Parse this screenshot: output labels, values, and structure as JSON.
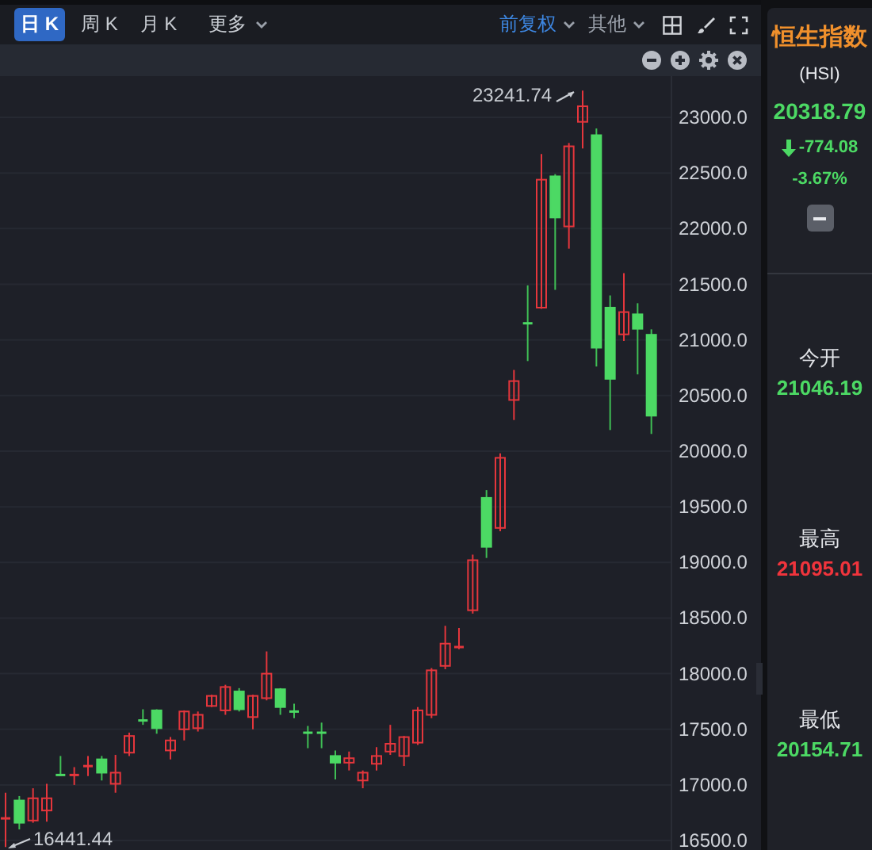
{
  "toolbar": {
    "tabs": [
      {
        "label": "日 K",
        "selected": true
      },
      {
        "label": "周 K",
        "selected": false
      },
      {
        "label": "月 K",
        "selected": false
      }
    ],
    "more": {
      "label": "更多"
    },
    "options": [
      {
        "label": "前复权",
        "active": true
      },
      {
        "label": "其他",
        "active": false
      }
    ]
  },
  "chart": {
    "max_label": "23241.74",
    "min_label": "16441.44",
    "chart_data": {
      "type": "candlestick",
      "categories": [
        null,
        null,
        null,
        null,
        null,
        null,
        null,
        null,
        null,
        null,
        null,
        null,
        null,
        null,
        null,
        null,
        null,
        null,
        null,
        null,
        null,
        null,
        null,
        null,
        null,
        null,
        null,
        null,
        null,
        null,
        null,
        null,
        null,
        null,
        null,
        null,
        null,
        null,
        null,
        null,
        null,
        null,
        null,
        null,
        null,
        null,
        null,
        null
      ],
      "ohlc": [
        [
          16700,
          16930,
          16441.44,
          16710
        ],
        [
          16860,
          16900,
          16600,
          16660
        ],
        [
          16680,
          16970,
          16660,
          16880
        ],
        [
          16770,
          17010,
          16670,
          16880
        ],
        [
          17100,
          17260,
          17080,
          17090
        ],
        [
          17090,
          17160,
          17000,
          17100
        ],
        [
          17170,
          17260,
          17080,
          17180
        ],
        [
          17230,
          17260,
          17040,
          17110
        ],
        [
          17010,
          17270,
          16930,
          17110
        ],
        [
          17290,
          17470,
          17260,
          17440
        ],
        [
          17590,
          17680,
          17540,
          17580
        ],
        [
          17670,
          17680,
          17460,
          17510
        ],
        [
          17310,
          17430,
          17230,
          17400
        ],
        [
          17500,
          17670,
          17400,
          17660
        ],
        [
          17510,
          17660,
          17480,
          17630
        ],
        [
          17710,
          17810,
          17700,
          17800
        ],
        [
          17670,
          17900,
          17630,
          17880
        ],
        [
          17840,
          17870,
          17660,
          17680
        ],
        [
          17610,
          17810,
          17500,
          17800
        ],
        [
          17780,
          18200,
          17760,
          18000
        ],
        [
          17860,
          17870,
          17630,
          17700
        ],
        [
          17670,
          17730,
          17600,
          17660
        ],
        [
          17480,
          17530,
          17330,
          17470
        ],
        [
          17480,
          17560,
          17330,
          17470
        ],
        [
          17260,
          17310,
          17050,
          17200
        ],
        [
          17200,
          17300,
          17130,
          17240
        ],
        [
          17040,
          17130,
          16970,
          17110
        ],
        [
          17190,
          17340,
          17130,
          17260
        ],
        [
          17300,
          17540,
          17270,
          17370
        ],
        [
          17260,
          17440,
          17170,
          17430
        ],
        [
          17380,
          17700,
          17360,
          17670
        ],
        [
          17630,
          18050,
          17600,
          18030
        ],
        [
          18070,
          18430,
          18040,
          18270
        ],
        [
          18240,
          18410,
          18220,
          18250
        ],
        [
          18570,
          19070,
          18540,
          19020
        ],
        [
          19580,
          19650,
          19040,
          19140
        ],
        [
          19310,
          19980,
          19280,
          19940
        ],
        [
          20460,
          20730,
          20280,
          20630
        ],
        [
          21160,
          21490,
          20810,
          21150
        ],
        [
          21290,
          22670,
          21280,
          22440
        ],
        [
          22470,
          22490,
          21450,
          22100
        ],
        [
          22020,
          22770,
          21820,
          22740
        ],
        [
          22960,
          23241.74,
          22720,
          23100
        ],
        [
          22840,
          22900,
          20760,
          20930
        ],
        [
          21290,
          21400,
          20190,
          20650
        ],
        [
          21050,
          21600,
          20990,
          21250
        ],
        [
          21230,
          21330,
          20690,
          21100
        ],
        [
          21046.19,
          21095.01,
          20154.71,
          20318.79
        ]
      ],
      "grid": true,
      "ylim": [
        16415,
        23371
      ],
      "yticks": [
        {
          "value": 23000,
          "label": "23000.0"
        },
        {
          "value": 22500,
          "label": "22500.0"
        },
        {
          "value": 22000,
          "label": "22000.0"
        },
        {
          "value": 21500,
          "label": "21500.0"
        },
        {
          "value": 21000,
          "label": "21000.0"
        },
        {
          "value": 20500,
          "label": "20500.0"
        },
        {
          "value": 20000,
          "label": "20000.0"
        },
        {
          "value": 19500,
          "label": "19500.0"
        },
        {
          "value": 19000,
          "label": "19000.0"
        },
        {
          "value": 18500,
          "label": "18500.0"
        },
        {
          "value": 18000,
          "label": "18000.0"
        },
        {
          "value": 17500,
          "label": "17500.0"
        },
        {
          "value": 17000,
          "label": "17000.0"
        },
        {
          "value": 16500,
          "label": "16500.0"
        }
      ]
    }
  },
  "quote": {
    "name": "恒生指数",
    "code": "(HSI)",
    "price": "20318.79",
    "change": "-774.08",
    "change_pct": "-3.67%",
    "up": false
  },
  "stats": [
    {
      "label": "今开",
      "value": "21046.19",
      "up": false
    },
    {
      "label": "最高",
      "value": "21095.01",
      "up": true
    },
    {
      "label": "最低",
      "value": "20154.71",
      "up": false
    }
  ]
}
